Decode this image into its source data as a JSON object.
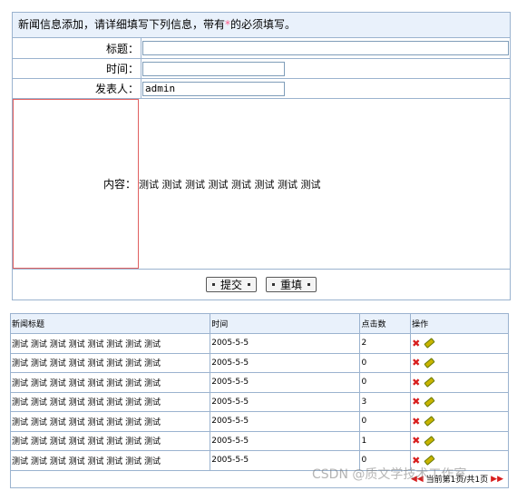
{
  "form": {
    "header_prefix": "新闻信息添加，请详细填写下列信息，带有",
    "header_mark": "*",
    "header_suffix": "的必须填写。",
    "title_label": "标题：",
    "title_value": "",
    "time_label": "时间：",
    "time_value": "",
    "author_label": "发表人：",
    "author_value": "admin",
    "content_label": "内容：",
    "content_value": "测试 测试 测试 测试 测试 测试 测试 测试",
    "submit_label": "提交",
    "reset_label": "重填"
  },
  "list": {
    "headers": [
      "新闻标题",
      "时间",
      "点击数",
      "操作"
    ],
    "rows": [
      {
        "title": "测试 测试 测试 测试 测试 测试 测试 测试",
        "time": "2005-5-5",
        "clicks": "2"
      },
      {
        "title": "测试 测试 测试 测试 测试 测试 测试 测试",
        "time": "2005-5-5",
        "clicks": "0"
      },
      {
        "title": "测试 测试 测试 测试 测试 测试 测试 测试",
        "time": "2005-5-5",
        "clicks": "0"
      },
      {
        "title": "测试 测试 测试 测试 测试 测试 测试 测试",
        "time": "2005-5-5",
        "clicks": "3"
      },
      {
        "title": "测试 测试 测试 测试 测试 测试 测试 测试",
        "time": "2005-5-5",
        "clicks": "0"
      },
      {
        "title": "测试 测试 测试 测试 测试 测试 测试 测试",
        "time": "2005-5-5",
        "clicks": "1"
      },
      {
        "title": "测试 测试 测试 测试 测试 测试 测试 测试",
        "time": "2005-5-5",
        "clicks": "0"
      }
    ],
    "pager_text": "当前第1页/共1页"
  },
  "watermark": "CSDN @质文学技术工作室",
  "colors": {
    "border": "#9bb3cf",
    "header_bg": "#e9f1fb",
    "required_mark": "#ff5c8a",
    "delete": "#d81e1e"
  }
}
